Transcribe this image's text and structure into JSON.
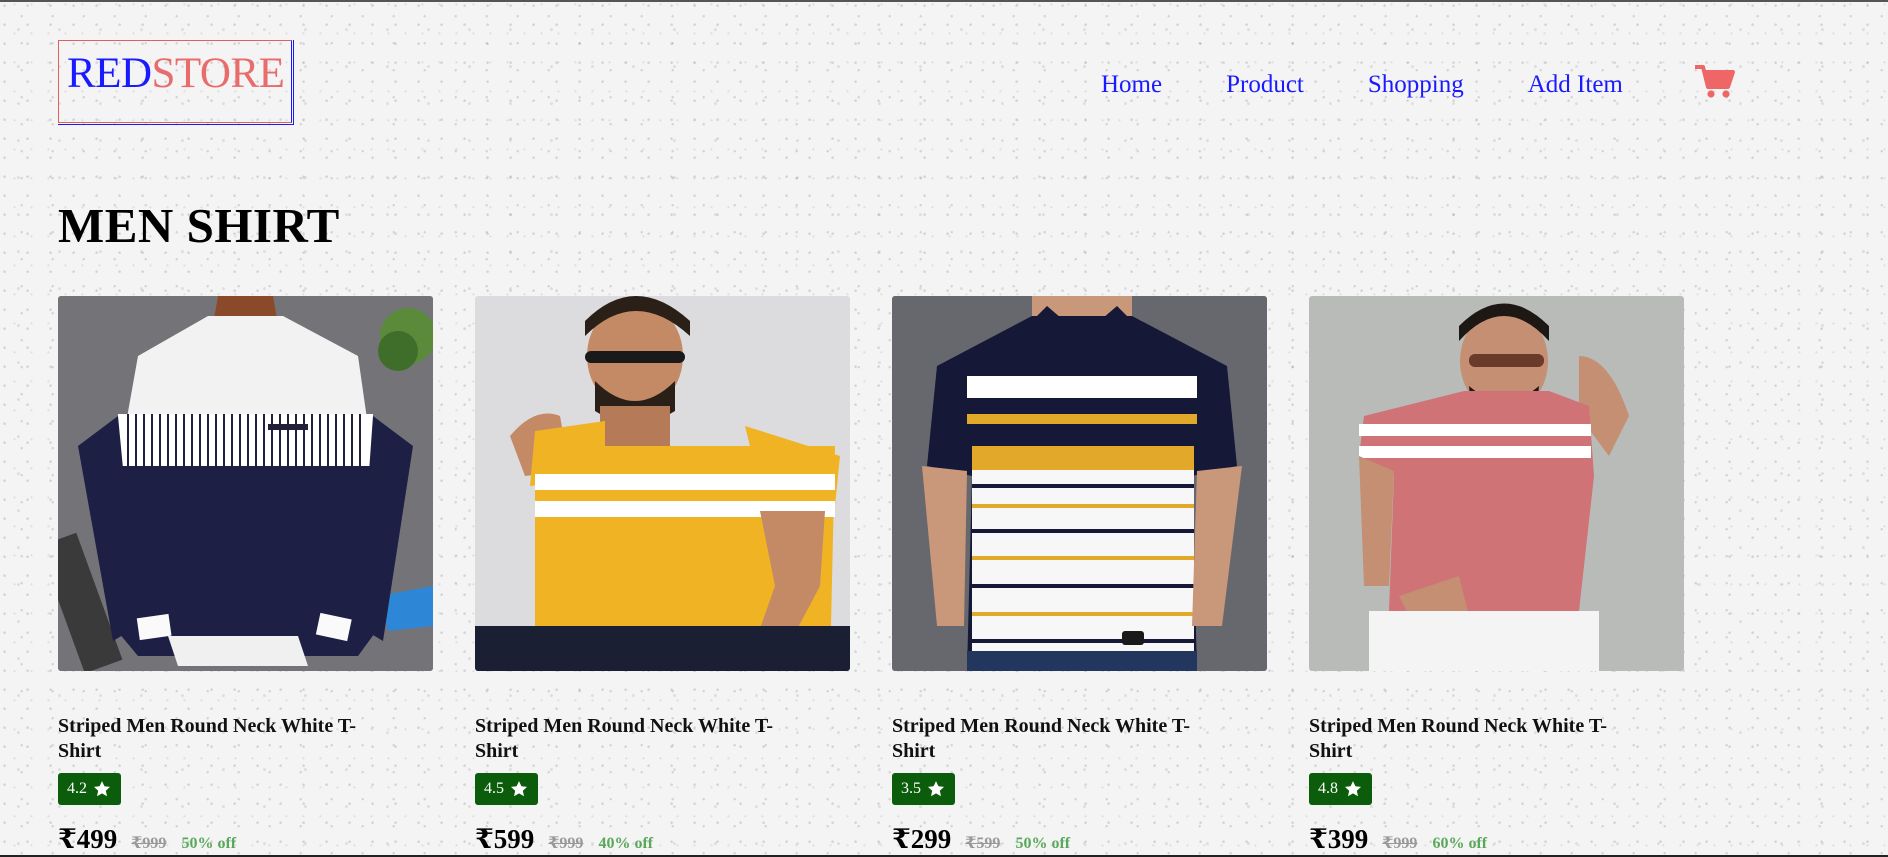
{
  "header": {
    "logo_part1": "RED",
    "logo_part2": "STORE",
    "nav": [
      "Home",
      "Product",
      "Shopping",
      "Add Item"
    ],
    "cart_icon": "shopping-cart-icon"
  },
  "main": {
    "title": "MEN SHIRT",
    "products": [
      {
        "title": "Striped Men Round Neck White T-Shirt",
        "rating": "4.2",
        "price": "₹499",
        "mrp": "₹999",
        "discount": "50% off"
      },
      {
        "title": "Striped Men Round Neck White T-Shirt",
        "rating": "4.5",
        "price": "₹599",
        "mrp": "₹999",
        "discount": "40% off"
      },
      {
        "title": "Striped Men Round Neck White T-Shirt",
        "rating": "3.5",
        "price": "₹299",
        "mrp": "₹599",
        "discount": "50% off"
      },
      {
        "title": "Striped Men Round Neck White T-Shirt",
        "rating": "4.8",
        "price": "₹399",
        "mrp": "₹999",
        "discount": "60% off"
      }
    ]
  },
  "colors": {
    "nav_link": "#1a1aff",
    "logo_accent": "#e86c6c",
    "rating_badge": "#0b5d0b",
    "discount": "#5aa85a"
  }
}
